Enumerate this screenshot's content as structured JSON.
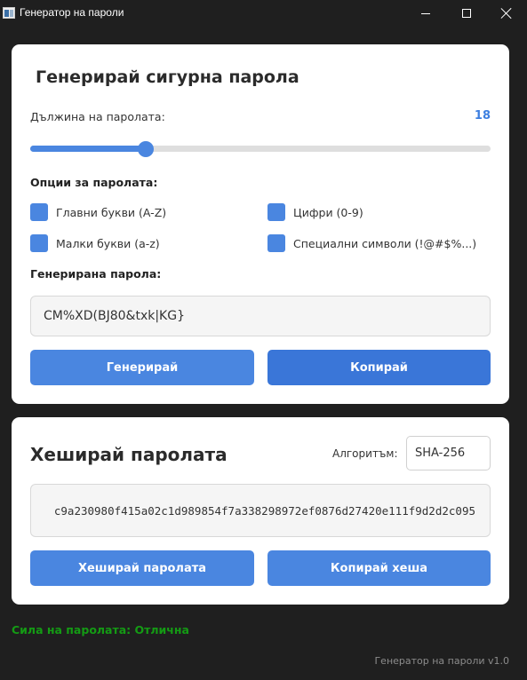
{
  "window": {
    "title": "Генератор на пароли",
    "icon": "app-window-icon"
  },
  "generator": {
    "heading": "Генерирай сигурна парола",
    "length_label": "Дължина на паролата:",
    "length_value": "18",
    "slider_fraction": 0.25,
    "options_title": "Опции за паролата:",
    "options": {
      "upper": "Главни букви (A-Z)",
      "lower": "Малки букви (a-z)",
      "digits": "Цифри (0-9)",
      "special": "Специални символи (!@#$%...)"
    },
    "generated_title": "Генерирана парола:",
    "password": "CM%XD(BJ80&txk|KG}",
    "generate_button": "Генерирай",
    "copy_button": "Копирай"
  },
  "hash": {
    "heading": "Хеширай паролата",
    "algorithm_label": "Алгоритъм:",
    "algorithm_value": "SHA-256",
    "hash_value": "c9a230980f415a02c1d989854f7a338298972ef0876d27420e111f9d2d2c095",
    "hash_button": "Хеширай паролата",
    "copy_hash_button": "Копирай хеша"
  },
  "status": {
    "strength": "Сила на паролата: Отлична"
  },
  "footer": {
    "version": "Генератор на пароли v1.0"
  },
  "colors": {
    "accent": "#4a86e0",
    "background": "#1f1f1f",
    "strength_good": "#149b14"
  }
}
